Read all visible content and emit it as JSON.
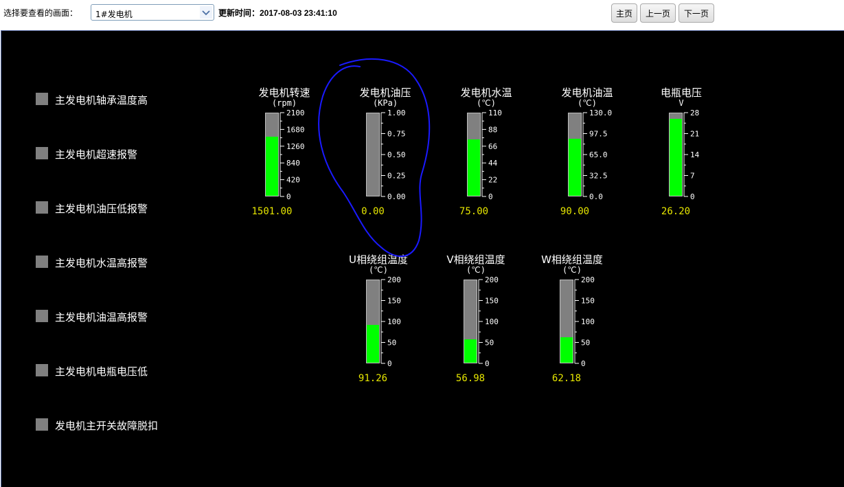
{
  "toolbar": {
    "select_label": "选择要查看的画面：",
    "selected_screen": "1#发电机",
    "update_time": "更新时间：2017-08-03 23:41:10",
    "btn_home": "主页",
    "btn_prev": "上一页",
    "btn_next": "下一页"
  },
  "alarms": [
    {
      "label": "主发电机轴承温度高",
      "active": false
    },
    {
      "label": "主发电机超速报警",
      "active": false
    },
    {
      "label": "主发电机油压低报警",
      "active": false
    },
    {
      "label": "主发电机水温高报警",
      "active": false
    },
    {
      "label": "主发电机油温高报警",
      "active": false
    },
    {
      "label": "主发电机电瓶电压低",
      "active": false
    },
    {
      "label": "发电机主开关故障脱扣",
      "active": false
    }
  ],
  "gauges": [
    {
      "id": "speed",
      "title": "发电机转速",
      "unit": "(rpm)",
      "ticks": [
        "2100",
        "1680",
        "1260",
        "840",
        "420",
        "0"
      ],
      "min": 0,
      "max": 2100,
      "value": 1501.0,
      "display": "1501.00"
    },
    {
      "id": "oilpress",
      "title": "发电机油压",
      "unit": "(KPa)",
      "ticks": [
        "1.00",
        "0.75",
        "0.50",
        "0.25",
        "0.00"
      ],
      "min": 0,
      "max": 1,
      "value": 0.0,
      "display": "0.00"
    },
    {
      "id": "watertemp",
      "title": "发电机水温",
      "unit": "(℃)",
      "ticks": [
        "110",
        "88",
        "66",
        "44",
        "22",
        "0"
      ],
      "min": 0,
      "max": 110,
      "value": 75.0,
      "display": "75.00"
    },
    {
      "id": "oiltemp",
      "title": "发电机油温",
      "unit": "(℃)",
      "ticks": [
        "130.0",
        "97.5",
        "65.0",
        "32.5",
        "0.0"
      ],
      "min": 0,
      "max": 130,
      "value": 90.0,
      "display": "90.00"
    },
    {
      "id": "battery",
      "title": "电瓶电压",
      "unit": "V",
      "ticks": [
        "28",
        "21",
        "14",
        "7",
        "0"
      ],
      "min": 0,
      "max": 28,
      "value": 26.2,
      "display": "26.20"
    },
    {
      "id": "utemp",
      "title": "U相绕组温度",
      "unit": "(℃)",
      "ticks": [
        "200",
        "150",
        "100",
        "50",
        "0"
      ],
      "min": 0,
      "max": 200,
      "value": 91.26,
      "display": "91.26"
    },
    {
      "id": "vtemp",
      "title": "V相绕组温度",
      "unit": "(℃)",
      "ticks": [
        "200",
        "150",
        "100",
        "50",
        "0"
      ],
      "min": 0,
      "max": 200,
      "value": 56.98,
      "display": "56.98"
    },
    {
      "id": "wtemp",
      "title": "W相绕组温度",
      "unit": "(℃)",
      "ticks": [
        "200",
        "150",
        "100",
        "50",
        "0"
      ],
      "min": 0,
      "max": 200,
      "value": 62.18,
      "display": "62.18"
    }
  ],
  "colors": {
    "panel_bg": "#000000",
    "fill_green": "#00ff00",
    "tube_gray": "#808080",
    "lamp_off": "#808080",
    "value_yellow": "#e6e600",
    "annotation_blue": "#1a1aff"
  }
}
